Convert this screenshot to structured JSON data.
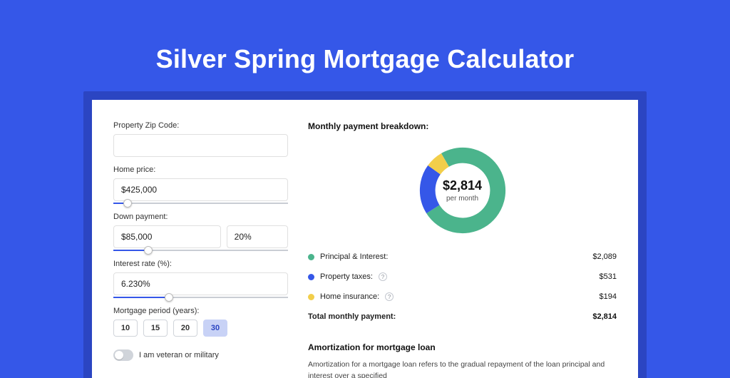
{
  "title": "Silver Spring Mortgage Calculator",
  "left": {
    "zip_label": "Property Zip Code:",
    "zip_value": "",
    "price_label": "Home price:",
    "price_value": "$425,000",
    "price_slider_pct": 8,
    "down_label": "Down payment:",
    "down_value": "$85,000",
    "down_pct_value": "20%",
    "down_slider_pct": 20,
    "rate_label": "Interest rate (%):",
    "rate_value": "6.230%",
    "rate_slider_pct": 32,
    "period_label": "Mortgage period (years):",
    "periods": [
      "10",
      "15",
      "20",
      "30"
    ],
    "period_active_index": 3,
    "vet_label": "I am veteran or military"
  },
  "right": {
    "breakdown_title": "Monthly payment breakdown:",
    "donut_amount": "$2,814",
    "donut_sub": "per month",
    "legend": [
      {
        "label": "Principal & Interest:",
        "value": "$2,089",
        "color": "#4bb48c",
        "info": false
      },
      {
        "label": "Property taxes:",
        "value": "$531",
        "color": "#3557e8",
        "info": true
      },
      {
        "label": "Home insurance:",
        "value": "$194",
        "color": "#f2ce4a",
        "info": true
      }
    ],
    "total_label": "Total monthly payment:",
    "total_value": "$2,814",
    "amort_title": "Amortization for mortgage loan",
    "amort_text": "Amortization for a mortgage loan refers to the gradual repayment of the loan principal and interest over a specified"
  },
  "chart_data": {
    "type": "pie",
    "title": "Monthly payment breakdown",
    "series": [
      {
        "name": "Principal & Interest",
        "value": 2089,
        "color": "#4bb48c"
      },
      {
        "name": "Property taxes",
        "value": 531,
        "color": "#3557e8"
      },
      {
        "name": "Home insurance",
        "value": 194,
        "color": "#f2ce4a"
      }
    ],
    "total": 2814,
    "center_label": "$2,814 per month"
  }
}
